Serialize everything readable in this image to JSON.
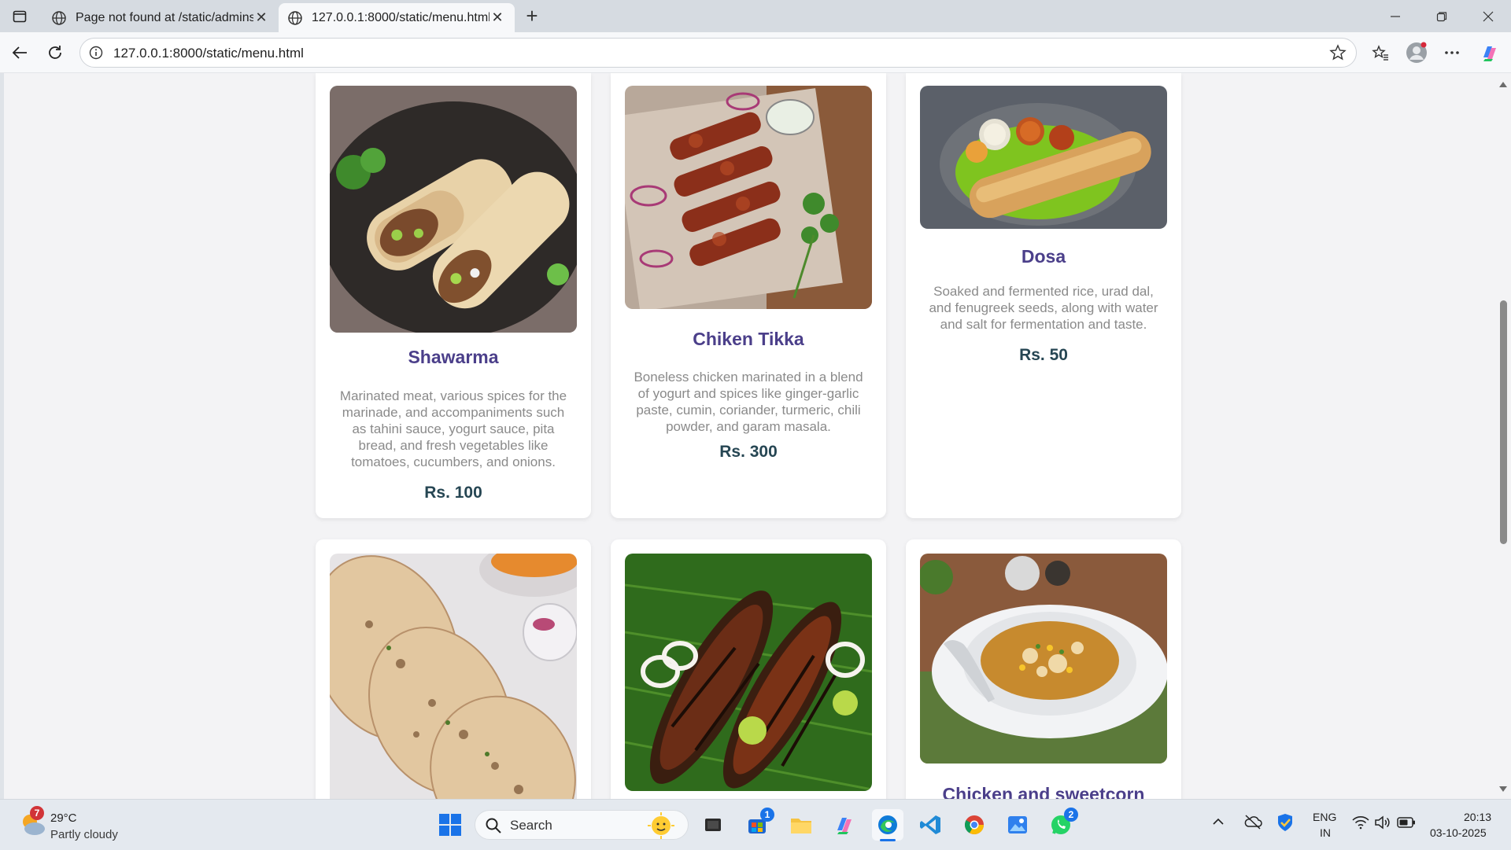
{
  "browser": {
    "tabs": [
      {
        "title": "Page not found at /static/adminst"
      },
      {
        "title": "127.0.0.1:8000/static/menu.html"
      }
    ],
    "url": "127.0.0.1:8000/static/menu.html"
  },
  "menu": {
    "items": [
      {
        "name": "Shawarma",
        "description": "Marinated meat, various spices for the marinade, and accompaniments such as tahini sauce, yogurt sauce, pita bread, and fresh vegetables like tomatoes, cucumbers, and onions.",
        "price": "Rs. 100"
      },
      {
        "name": "Chiken Tikka",
        "description": "Boneless chicken marinated in a blend of yogurt and spices like ginger-garlic paste, cumin, coriander, turmeric, chili powder, and garam masala.",
        "price": "Rs. 300"
      },
      {
        "name": "Dosa",
        "description": "Soaked and fermented rice, urad dal, and fenugreek seeds, along with water and salt for fermentation and taste.",
        "price": "Rs. 50"
      },
      {
        "name": "",
        "description": "",
        "price": ""
      },
      {
        "name": "",
        "description": "",
        "price": ""
      },
      {
        "name": "Chicken and sweetcorn",
        "description": "",
        "price": ""
      }
    ]
  },
  "taskbar": {
    "weather": {
      "temp": "29°C",
      "condition": "Partly cloudy",
      "badge": "7"
    },
    "search_placeholder": "Search",
    "store_badge": "1",
    "whatsapp_badge": "2",
    "lang_top": "ENG",
    "lang_bottom": "IN",
    "time": "20:13",
    "date": "03-10-2025"
  },
  "colors": {
    "title": "#4b3f8a",
    "price": "#264653",
    "description": "#8a8a8a"
  }
}
